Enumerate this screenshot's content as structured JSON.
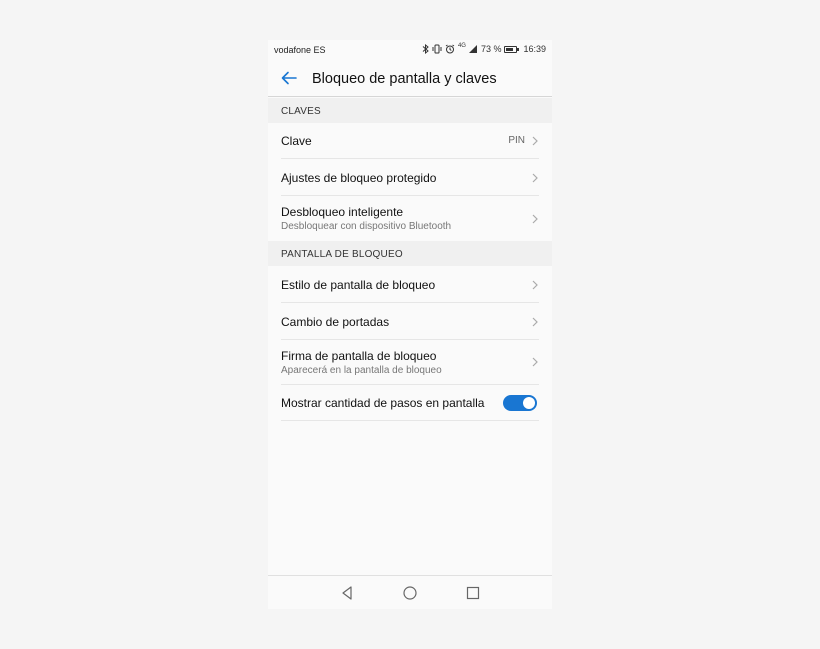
{
  "status_bar": {
    "carrier": "vodafone ES",
    "network": "4G",
    "battery_percent": "73 %",
    "time": "16:39"
  },
  "header": {
    "title": "Bloqueo de pantalla y claves"
  },
  "sections": [
    {
      "title": "CLAVES",
      "items": [
        {
          "label": "Clave",
          "value": "PIN"
        },
        {
          "label": "Ajustes de bloqueo protegido"
        },
        {
          "label": "Desbloqueo inteligente",
          "subtitle": "Desbloquear con dispositivo Bluetooth"
        }
      ]
    },
    {
      "title": "PANTALLA DE BLOQUEO",
      "items": [
        {
          "label": "Estilo de pantalla de bloqueo"
        },
        {
          "label": "Cambio de portadas"
        },
        {
          "label": "Firma de pantalla de bloqueo",
          "subtitle": "Aparecerá en la pantalla de bloqueo"
        },
        {
          "label": "Mostrar cantidad de pasos en pantalla",
          "toggle_on": true
        }
      ]
    }
  ],
  "colors": {
    "accent": "#1976d2",
    "background": "#fafafa",
    "section_header_bg": "#f0f0f0"
  }
}
